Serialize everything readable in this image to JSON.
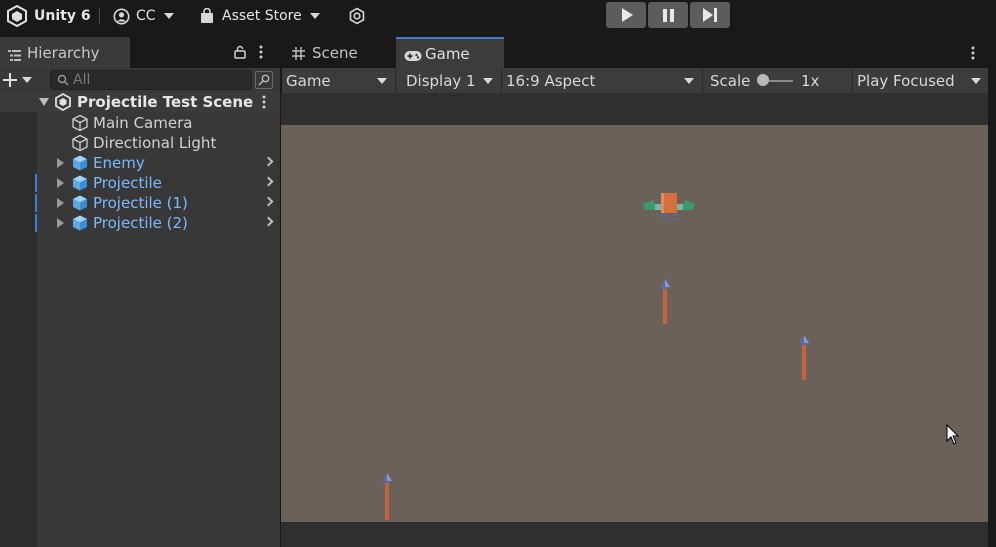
{
  "topbar": {
    "unity_label": "Unity 6",
    "account_label": "CC",
    "store_label": "Asset Store"
  },
  "hierarchy": {
    "tab_label": "Hierarchy",
    "search_placeholder": "All",
    "scene_name": "Projectile Test Scene",
    "items": [
      {
        "label": "Main Camera"
      },
      {
        "label": "Directional Light"
      },
      {
        "label": "Enemy"
      },
      {
        "label": "Projectile"
      },
      {
        "label": "Projectile (1)"
      },
      {
        "label": "Projectile (2)"
      }
    ]
  },
  "view_tabs": {
    "scene_label": "Scene",
    "game_label": "Game"
  },
  "game_toolbar": {
    "mode": "Game",
    "display": "Display 1",
    "aspect": "16:9 Aspect",
    "scale_label": "Scale",
    "scale_value": "1x",
    "play_mode": "Play Focused"
  },
  "colors": {
    "game_background": "#6a6159",
    "projectile_shaft": "#c4633f",
    "projectile_tip": "#5a6a9a",
    "prefab_blue": "#7fb8ff",
    "active_tab_accent": "#3d7bd6"
  }
}
